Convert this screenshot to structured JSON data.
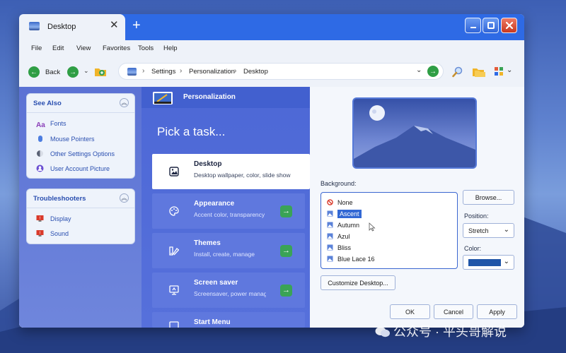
{
  "window": {
    "tab_title": "Desktop",
    "tab_close": "✕",
    "new_tab": "+"
  },
  "menu": [
    "File",
    "Edit",
    "View",
    "Favorites",
    "Tools",
    "Help"
  ],
  "nav": {
    "back_label": "Back",
    "breadcrumbs": [
      "Settings",
      "Personalization",
      "Desktop"
    ]
  },
  "see_also": {
    "title": "See Also",
    "items": [
      "Fonts",
      "Mouse Pointers",
      "Other Settings Options",
      "User Account Picture"
    ]
  },
  "troubleshooters": {
    "title": "Troubleshooters",
    "items": [
      "Display",
      "Sound"
    ]
  },
  "personalization": {
    "header": "Personalization",
    "pick_title": "Pick a task...",
    "tasks": [
      {
        "title": "Desktop",
        "subtitle": "Desktop wallpaper, color, slide show"
      },
      {
        "title": "Appearance",
        "subtitle": "Accent color, transparency"
      },
      {
        "title": "Themes",
        "subtitle": "Install, create, manage"
      },
      {
        "title": "Screen saver",
        "subtitle": "Screensaver, power management"
      },
      {
        "title": "Start Menu",
        "subtitle": ""
      }
    ]
  },
  "desktop_settings": {
    "background_label": "Background:",
    "backgrounds": [
      "None",
      "Ascent",
      "Autumn",
      "Azul",
      "Bliss",
      "Blue Lace 16"
    ],
    "selected_background": "Ascent",
    "browse_label": "Browse...",
    "position_label": "Position:",
    "position_value": "Stretch",
    "color_label": "Color:",
    "color_value": "#1f55a8",
    "customize_label": "Customize Desktop...",
    "ok_label": "OK",
    "cancel_label": "Cancel",
    "apply_label": "Apply"
  },
  "watermark": "公众号 · 平头哥解说",
  "colors": {
    "accent": "#2e6ae5",
    "selection": "#3268d4",
    "go_green": "#3aa356"
  }
}
